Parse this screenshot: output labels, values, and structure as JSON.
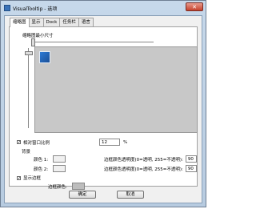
{
  "window": {
    "title": "VisualTooltip - 选项",
    "close_symbol": "✕"
  },
  "tabs": [
    {
      "label": "缩略图"
    },
    {
      "label": "显示"
    },
    {
      "label": "Dock"
    },
    {
      "label": "任务栏"
    },
    {
      "label": "语言"
    }
  ],
  "thumbnail": {
    "min_size_label": "缩略图最小尺寸",
    "keep_ratio_label": "相对窗口比例",
    "keep_ratio_checked": true,
    "ratio_value": "12",
    "ratio_unit": "%"
  },
  "background": {
    "section_label": "背景",
    "color1_label": "颜色 1:",
    "color2_label": "颜色 2:",
    "color1": "#f0f0f0",
    "color2": "#f0f0f0",
    "border_transparency_label": "边框颜色透明度(0=透明, 255=不透明):",
    "border_transparency_value": "90",
    "border_transparency2_label": "边框颜色透明度(0=透明, 255=不透明):",
    "border_transparency2_value": "90"
  },
  "border": {
    "show_label": "显示边框",
    "show_checked": true,
    "color_label": "边框颜色:",
    "color": "#bdbdbd"
  },
  "buttons": {
    "ok_label": "确定",
    "cancel_label": "取消"
  }
}
